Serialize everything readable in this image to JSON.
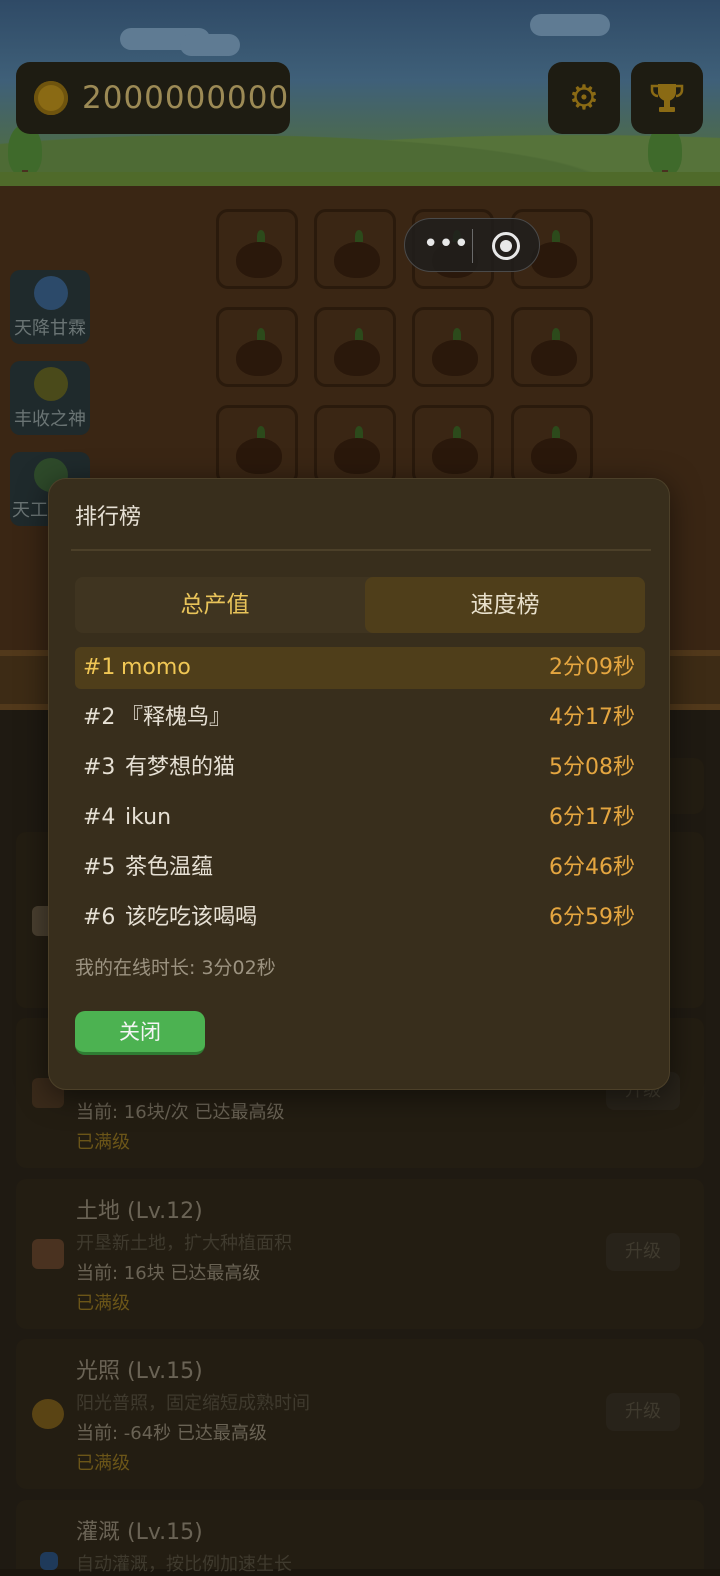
{
  "coins": {
    "value": "2000000000"
  },
  "header": {
    "settings_icon": "gear-icon",
    "ranking_icon": "trophy-icon"
  },
  "capsule": {
    "more_icon": "•••",
    "close_icon": "target-icon"
  },
  "skills": [
    {
      "label": "天降甘霖",
      "icon": "rain-cloud-icon"
    },
    {
      "label": "丰收之神",
      "icon": "harvest-medal-icon"
    },
    {
      "label": "天工",
      "icon": "robot-icon"
    }
  ],
  "cards": [
    {
      "title": "",
      "desc": "",
      "current": "当前: 16块/次  已达最高级",
      "status": "已满级",
      "button": "升级"
    },
    {
      "title": "土地 (Lv.12)",
      "desc": "开垦新土地，扩大种植面积",
      "current": "当前: 16块  已达最高级",
      "status": "已满级",
      "button": "升级"
    },
    {
      "title": "光照 (Lv.15)",
      "desc": "阳光普照，固定缩短成熟时间",
      "current": "当前: -64秒  已达最高级",
      "status": "已满级",
      "button": "升级"
    },
    {
      "title": "灌溉 (Lv.15)",
      "desc": "自动灌溉，按比例加速生长",
      "current": "",
      "status": "",
      "button": ""
    }
  ],
  "modal": {
    "title": "排行榜",
    "tabs": [
      "总产值",
      "速度榜"
    ],
    "rows": [
      {
        "rank": "#1",
        "name": "momo",
        "time": "2分09秒"
      },
      {
        "rank": "#2",
        "name": "『释槐鸟』",
        "time": "4分17秒"
      },
      {
        "rank": "#3",
        "name": "有梦想的猫",
        "time": "5分08秒"
      },
      {
        "rank": "#4",
        "name": "ikun",
        "time": "6分17秒"
      },
      {
        "rank": "#5",
        "name": "茶色温蕴",
        "time": "6分46秒"
      },
      {
        "rank": "#6",
        "name": "该吃吃该喝喝",
        "time": "6分59秒"
      }
    ],
    "online": "我的在线时长: 3分02秒",
    "close_label": "关闭"
  },
  "colors": {
    "accent_gold": "#e5a640",
    "close_green": "#4cb251",
    "modal_bg": "#382e1c"
  }
}
